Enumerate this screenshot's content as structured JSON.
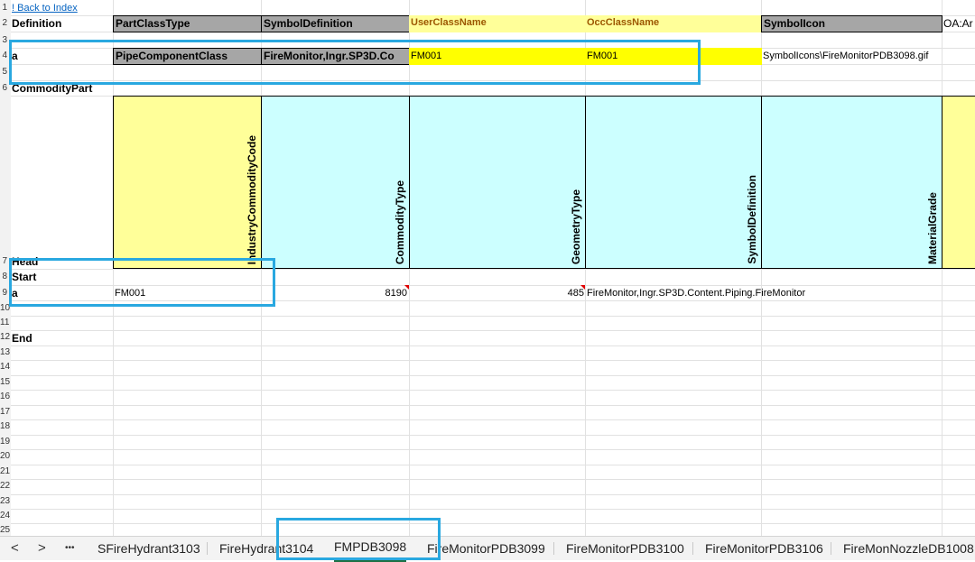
{
  "sheet": {
    "link_back": "! Back to Index",
    "row_numbers": [
      "1",
      "2",
      "3",
      "4",
      "5",
      "6",
      "7",
      "8",
      "9",
      "10",
      "11",
      "12",
      "13",
      "14",
      "15",
      "16",
      "17",
      "18",
      "19",
      "20",
      "21",
      "22",
      "23",
      "24",
      "25"
    ],
    "definition_label": "Definition",
    "definition_headers": [
      "PartClassType",
      "SymbolDefinition",
      "UserClassName",
      "OccClassName",
      "SymbolIcon",
      "OA:Ar"
    ],
    "row4": {
      "label": "a",
      "part_class_type": "PipeComponentClass",
      "symbol_definition": "FireMonitor,Ingr.SP3D.Co",
      "user_class_name": "FM001",
      "occ_class_name": "FM001",
      "symbol_icon": "SymbolIcons\\FireMonitorPDB3098.gif"
    },
    "commodity_part_label": "CommodityPart",
    "commodity_headers": [
      "IndustryCommodityCode",
      "CommodityType",
      "GeometryType",
      "SymbolDefinition",
      "MaterialGrade"
    ],
    "head_label": "Head",
    "start_label": "Start",
    "row9": {
      "label": "a",
      "industry_commodity_code": "FM001",
      "commodity_type": "8190",
      "geometry_type": "485",
      "symbol_definition": "FireMonitor,Ingr.SP3D.Content.Piping.FireMonitor"
    },
    "end_label": "End"
  },
  "tabs": {
    "nav_prev": "<",
    "nav_next": ">",
    "more": "•••",
    "items": [
      "SFireHydrant3103",
      "FireHydrant3104",
      "FMPDB3098",
      "FireMonitorPDB3099",
      "FireMonitorPDB3100",
      "FireMonitorPDB3106",
      "FireMonNozzleDB1008"
    ],
    "active": "FMPDB3098"
  },
  "colors": {
    "header_gray": "#a6a6a6",
    "header_yellow": "#ffff99",
    "value_yellow": "#ffff00",
    "cyan": "#ccffff",
    "highlight_blue": "#29a8e0"
  }
}
